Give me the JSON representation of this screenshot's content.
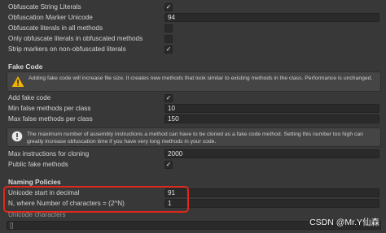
{
  "top_settings": [
    {
      "label": "Obfuscate String Literals",
      "checked": true
    },
    {
      "label": "Obfuscation Marker Unicode",
      "value": "94"
    },
    {
      "label": "Obfuscate literals in all methods",
      "checked": false
    },
    {
      "label": "Only obfuscate literals in obfuscated methods",
      "checked": false
    },
    {
      "label": "Strip markers on non-obfuscated literals",
      "checked": true
    }
  ],
  "fake_code": {
    "title": "Fake Code",
    "warning": "Adding fake code will increase file size. It creates new methods that look similar to existing methods in the class. Performance is unchanged.",
    "add_fake_code_label": "Add fake code",
    "min_false_label": "Min false methods per class",
    "min_false_value": "10",
    "max_false_label": "Max false methods per class",
    "max_false_value": "150",
    "info": "The maximum number of assembly instructions a method can have to be cloned as a fake code method. Setting this number too high can greatly increase obfuscation time if you have very long methods in your code.",
    "max_instructions_label": "Max instructions for cloning",
    "max_instructions_value": "2000",
    "public_fake_label": "Public fake methods"
  },
  "naming": {
    "title": "Naming Policies",
    "unicode_start_label": "Unicode start in decimal",
    "unicode_start_value": "91",
    "n_chars_label": "N, where Number of characters = (2^N)",
    "n_chars_value": "1",
    "unicode_chars_label": "Unicode characters",
    "unicode_chars_value": "[]"
  },
  "checkmark": "✓",
  "watermark": "CSDN @Mr.Y仙森",
  "colors": {
    "background": "#383838",
    "field": "#2a2a2a",
    "highlight": "#e0281c",
    "warning_icon": "#f2b400"
  }
}
